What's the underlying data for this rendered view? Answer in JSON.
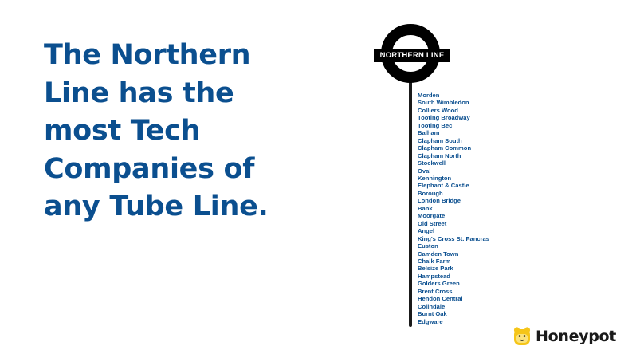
{
  "headline": {
    "lines": [
      "The Northern",
      "Line has the",
      "most Tech",
      "Companies of",
      "any Tube Line."
    ]
  },
  "roundel": {
    "label": "NORTHERN LINE"
  },
  "stations": [
    "Morden",
    "South Wimbledon",
    "Colliers Wood",
    "Tooting Broadway",
    "Tooting Bec",
    "Balham",
    "Clapham South",
    "Clapham Common",
    "Clapham North",
    "Stockwell",
    "Oval",
    "Kennington",
    "Elephant & Castle",
    "Borough",
    "London Bridge",
    "Bank",
    "Moorgate",
    "Old Street",
    "Angel",
    "King's Cross St. Pancras",
    "Euston",
    "Camden Town",
    "Chalk Farm",
    "Belsize Park",
    "Hampstead",
    "Golders Green",
    "Brent Cross",
    "Hendon Central",
    "Colindale",
    "Burnt Oak",
    "Edgware"
  ],
  "brand": {
    "name": "Honeypot",
    "logo_icon": "honeypot-bear-icon"
  },
  "colors": {
    "headline": "#0b4f8f",
    "roundel": "#000000",
    "logo": "#f5c518"
  }
}
